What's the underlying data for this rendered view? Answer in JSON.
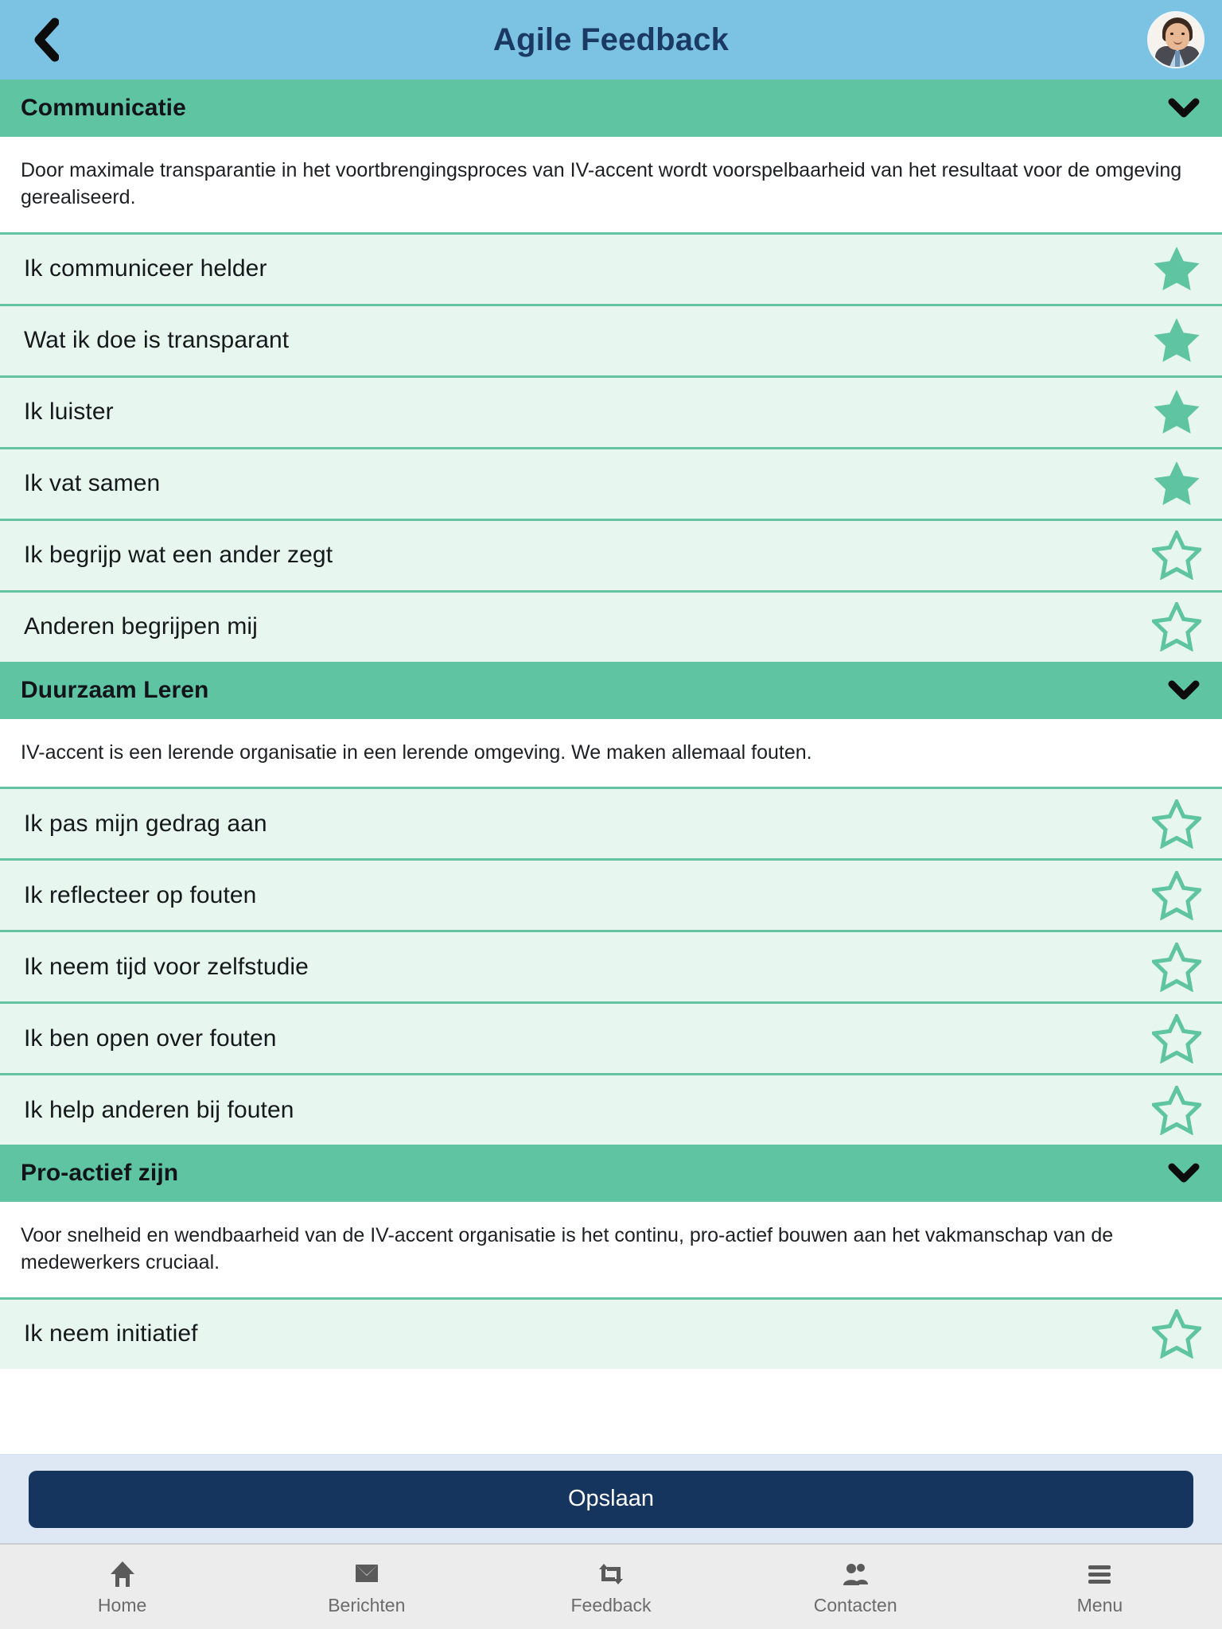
{
  "header": {
    "back_icon": "chevron-left-icon",
    "title": "Agile Feedback",
    "avatar_alt": "profile-avatar"
  },
  "sections": [
    {
      "title": "Communicatie",
      "chevron_icon": "chevron-down-icon",
      "description": "Door maximale transparantie in het voortbrengingsproces van IV-accent wordt voorspelbaarheid van het resultaat voor de omgeving gerealiseerd.",
      "items": [
        {
          "label": "Ik communiceer helder",
          "starred": true
        },
        {
          "label": "Wat ik doe is transparant",
          "starred": true
        },
        {
          "label": "Ik luister",
          "starred": true
        },
        {
          "label": "Ik vat samen",
          "starred": true
        },
        {
          "label": "Ik begrijp wat een ander zegt",
          "starred": false
        },
        {
          "label": "Anderen begrijpen mij",
          "starred": false
        }
      ]
    },
    {
      "title": "Duurzaam Leren",
      "chevron_icon": "chevron-down-icon",
      "description": "IV-accent is een lerende organisatie in een lerende omgeving. We maken allemaal fouten.",
      "items": [
        {
          "label": "Ik pas mijn gedrag aan",
          "starred": false
        },
        {
          "label": "Ik reflecteer op fouten",
          "starred": false
        },
        {
          "label": "Ik neem tijd voor zelfstudie",
          "starred": false
        },
        {
          "label": "Ik ben open over fouten",
          "starred": false
        },
        {
          "label": "Ik help anderen bij fouten",
          "starred": false
        }
      ]
    },
    {
      "title": "Pro-actief zijn",
      "chevron_icon": "chevron-down-icon",
      "description": "Voor snelheid en wendbaarheid van de IV-accent organisatie is het continu, pro-actief bouwen aan het vakmanschap van de medewerkers cruciaal.",
      "items": [
        {
          "label": "Ik neem initiatief",
          "starred": false
        }
      ]
    }
  ],
  "save_bar": {
    "label": "Opslaan"
  },
  "tabbar": [
    {
      "label": "Home",
      "icon": "home-icon"
    },
    {
      "label": "Berichten",
      "icon": "envelope-icon"
    },
    {
      "label": "Feedback",
      "icon": "retweet-icon"
    },
    {
      "label": "Contacten",
      "icon": "people-icon"
    },
    {
      "label": "Menu",
      "icon": "hamburger-icon"
    }
  ],
  "colors": {
    "header_bg": "#7CC3E3",
    "header_text": "#1B3A63",
    "section_bg": "#5FC4A1",
    "row_bg": "#E7F7F0",
    "row_border": "#63C3A2",
    "star": "#5FC4A1",
    "save_bar_bg": "#DEE8F5",
    "save_btn_bg": "#16355E",
    "tabbar_bg": "#ECECEC",
    "tab_label": "#6B6B6B"
  }
}
